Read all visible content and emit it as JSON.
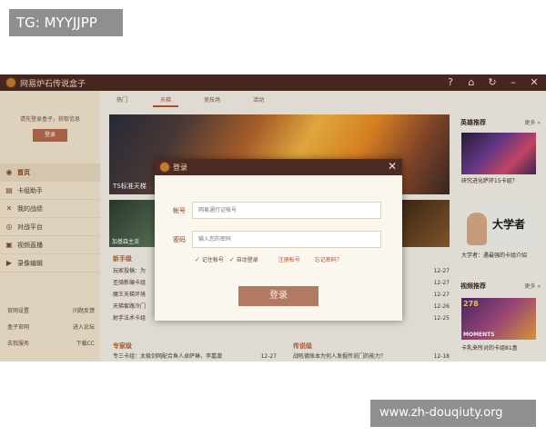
{
  "watermarks": {
    "top": "TG: MYYJJPP",
    "bottom": "www.zh-douqiuty.org"
  },
  "app": {
    "title": "网易炉石传说盒子",
    "titlebar_icons": [
      "help-icon",
      "shirt-icon",
      "refresh-icon",
      "minimize-icon",
      "close-icon"
    ]
  },
  "sidebar": {
    "login_hint": "请先登录盒子，获取信息",
    "login_button": "登录",
    "nav": [
      {
        "label": "首页",
        "icon": "home-icon",
        "active": true
      },
      {
        "label": "卡组助手",
        "icon": "cards-icon"
      },
      {
        "label": "我的战绩",
        "icon": "swords-icon"
      },
      {
        "label": "对战平台",
        "icon": "target-icon"
      },
      {
        "label": "视频直播",
        "icon": "tv-icon"
      },
      {
        "label": "录像编辑",
        "icon": "film-icon"
      }
    ],
    "quicklinks": [
      [
        "官网设置",
        "问题反馈"
      ],
      [
        "盒子官网",
        "进入论坛"
      ],
      [
        "去我服务",
        "下载CC"
      ]
    ]
  },
  "tabs": [
    "热门",
    "天梯",
    "竞技场",
    "活动"
  ],
  "banner": {
    "caption": "TS标准天梯"
  },
  "thumbs": {
    "left_caption": "加基森主流"
  },
  "news_left": {
    "heading": "新手级",
    "items": [
      {
        "title": "玩家投稿：为",
        "date": ""
      },
      {
        "title": "圣骑新编卡组",
        "date": ""
      },
      {
        "title": "魔王天梯环境",
        "date": ""
      },
      {
        "title": "天梯套路冷门",
        "date": ""
      },
      {
        "title": "射手法术卡组",
        "date": ""
      }
    ]
  },
  "news_left_dates": [
    "12-27",
    "12-27",
    "12-27",
    "12-26",
    "12-25"
  ],
  "news_bottom": {
    "col1_heading": "专家级",
    "col1_item": "专三卡组：太极剑网配合鱼人卓萨琳，李嘉澈",
    "col1_date": "12-27",
    "col2_heading": "传说级",
    "col2_item": "战吼德账本为何人发掘传说门的能力？",
    "col2_date": "12-18"
  },
  "right": {
    "video_head": "英雄推荐",
    "video_more": "更多 »",
    "img_a_caption": "研究进化萨环15卡组？",
    "img_b_text": "大学者",
    "img_b_caption": "大学者：遇最强的卡组介绍",
    "video2_head": "视频推荐",
    "video2_more": "更多 »",
    "img_c_badge": "278",
    "img_c_overlay": "MOMENTS",
    "img_c_caption": "卡乳来所对的卡组81盒"
  },
  "modal": {
    "title": "登录",
    "account_label": "帐号",
    "account_placeholder": "网易通行证帐号",
    "password_label": "密码",
    "password_placeholder": "输入您的密码",
    "remember": "记住帐号",
    "autologin": "自动登录",
    "register": "注册帐号",
    "forgot": "忘记密码？",
    "submit": "登录"
  }
}
